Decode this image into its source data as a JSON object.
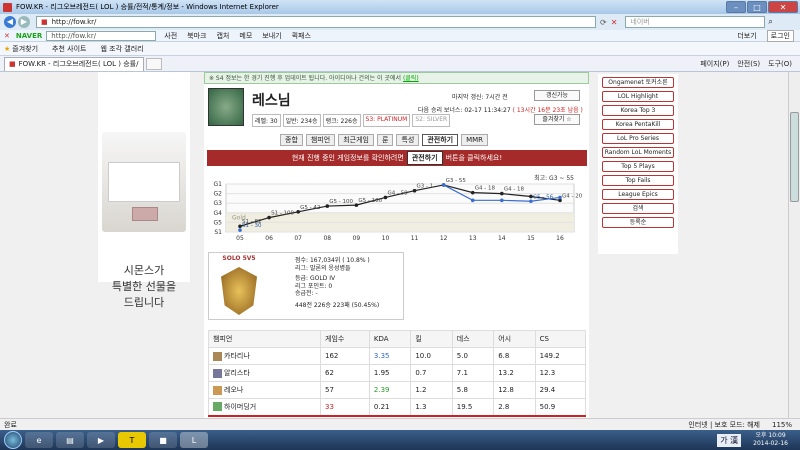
{
  "window": {
    "title": "FOW.KR - 리그오브레전드( LOL ) 승률/전적/통계/정보 - Windows Internet Explorer"
  },
  "address": {
    "url": "http://fow.kr/",
    "search_placeholder": "네이버"
  },
  "toolbar1": {
    "naver": "NAVER",
    "url": "http://fow.kr/",
    "dict": "사전",
    "bookmark": "북마크",
    "capture": "캡처",
    "memo": "메모",
    "send": "보내기",
    "fastpass": "퀵패스",
    "more": "더보기",
    "login": "로그인"
  },
  "favbar": {
    "favorites": "즐겨찾기",
    "suggested": "추천 사이트",
    "gallery": "웹 조각 갤러리",
    "page": "페이지(P)",
    "safety": "안전(S)",
    "tools": "도구(O)"
  },
  "tab": {
    "label": "FOW.KR - 리그오브레전드( LOL ) 승률/전적/통..."
  },
  "notice": {
    "text": "※ S4 정보는 한 경기 진행 후 업데이트 됩니다. 아이디어나 건의는 이 곳에서",
    "link": "(클릭)"
  },
  "profile": {
    "name": "레스님",
    "level": "레벨: 30",
    "normal": "일반: 234승",
    "rank": "랭크: 226승",
    "s3": "S3: PLATINUM",
    "s2": "S2: SILVER",
    "last_update": "마지막 갱신: 7시간 전",
    "next_win": "다음 승리 보너스: 02-17 11:34:27",
    "remaining": "( 13시간 16분 23초 남음 )",
    "refresh_btn": "갱신가능",
    "fav_btn": "즐겨찾기 ☆"
  },
  "tabs": [
    "종합",
    "챔피언",
    "최근게임",
    "룬",
    "특성",
    "관전하기",
    "MMR"
  ],
  "banner": {
    "pre": "현재 진행 중인 게임정보를 확인하려면",
    "btn": "관전하기",
    "post": "버튼을 클릭하세요!"
  },
  "chart_data": {
    "type": "line",
    "title": "최고: G3 ~ 55",
    "categories": [
      "05",
      "06",
      "07",
      "08",
      "09",
      "10",
      "11",
      "12",
      "13",
      "14",
      "15",
      "16"
    ],
    "y_ticks": [
      "G1",
      "G2",
      "G3",
      "G4",
      "G5",
      "S1"
    ],
    "band_label": "Gold",
    "series": [
      {
        "name": "",
        "color": "#222222",
        "values": [
          0.6,
          1.5,
          2.1,
          2.7,
          2.8,
          3.6,
          4.3,
          4.9,
          4.1,
          4.0,
          3.7,
          3.3
        ],
        "labels": [
          "S1 - 82",
          "S1 - 100",
          "G5 - 42",
          "G5 - 100",
          "G5 - 100",
          "G4 - 59",
          "G3 - 1",
          "G3 - 55",
          "G4 - 18",
          "G4 - 18",
          "",
          "G4 - 20"
        ]
      },
      {
        "name": "",
        "color": "#3a6fd0",
        "values": [
          0.2,
          null,
          null,
          null,
          null,
          null,
          null,
          4.9,
          3.3,
          3.3,
          3.2,
          3.6
        ],
        "labels": [
          "S1 - 30",
          "",
          "",
          "",
          "",
          "",
          "",
          "",
          "",
          "",
          "G5 - 56",
          ""
        ]
      }
    ]
  },
  "solo": {
    "queue": "SOLO 5V5",
    "tier_points": "점수: 167,034위 ( 10.8% )",
    "league": "리그: 말론의 응성병들",
    "rank": "등급: GOLD IV",
    "lp": "리그 포인트: 0",
    "series": "승급전: -",
    "record": "448전 226승 223패 (50.45%)"
  },
  "table": {
    "headers": [
      "챔피언",
      "게임수",
      "KDA",
      "킬",
      "데스",
      "어시",
      "CS"
    ],
    "rows": [
      [
        "카타리나",
        "162",
        "3.35",
        "10.0",
        "5.0",
        "6.8",
        "149.2"
      ],
      [
        "알리스타",
        "62",
        "1.95",
        "0.7",
        "7.1",
        "13.2",
        "12.3"
      ],
      [
        "레오나",
        "57",
        "2.39",
        "1.2",
        "5.8",
        "12.8",
        "29.4"
      ],
      [
        "하이머딩거",
        "33",
        "0.21",
        "1.3",
        "19.5",
        "2.8",
        "50.9"
      ]
    ]
  },
  "ad": {
    "line1": "시몬스가",
    "line2": "특별한 선물을",
    "line3": "드립니다"
  },
  "rightnav": [
    "Ongamenet 토커소른",
    "LOL Highlight",
    "Korea Top 3",
    "Korea PentaKill",
    "LoL Pro Series",
    "Random LoL Moments",
    "Top 5 Plays",
    "Top Fails",
    "League Epics",
    "검색",
    "등록순"
  ],
  "status": {
    "left": "완료",
    "zone": "인터넷 | 보호 모드: 해제",
    "zoom": "115%"
  },
  "taskbar": {
    "lang": "가 漢",
    "time": "오후 10:09",
    "date": "2014-02-16"
  }
}
